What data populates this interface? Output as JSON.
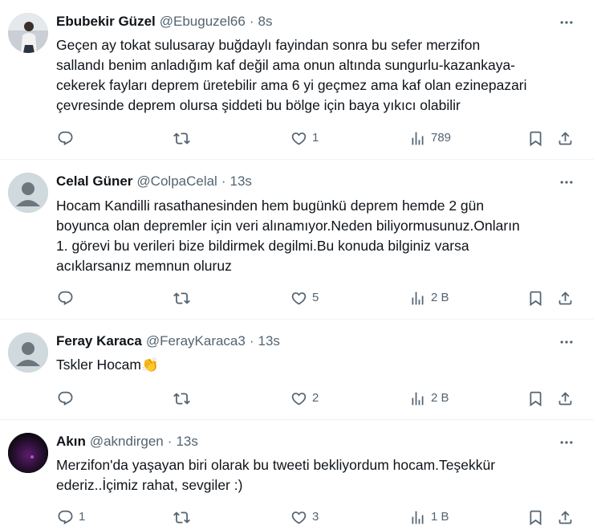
{
  "tweets": [
    {
      "name": "Ebubekir Güzel",
      "handle": "@Ebuguzel66",
      "time": "8s",
      "text": "Geçen ay tokat sulusaray buğdaylı fayindan sonra bu sefer merzifon\nsallandı benim anladığım kaf değil ama onun altında sungurlu-kazankaya-\ncekerek fayları deprem üretebilir ama 6 yi geçmez ama kaf olan ezinepazari\nçevresinde deprem olursa şiddeti bu bölge için baya yıkıcı olabilir",
      "replies": "",
      "retweets": "",
      "likes": "1",
      "views": "789"
    },
    {
      "name": "Celal Güner",
      "handle": "@ColpaCelal",
      "time": "13s",
      "text": "Hocam Kandilli rasathanesinden hem bugünkü deprem hemde 2 gün\nboyunca olan depremler için veri alınamıyor.Neden biliyormusunuz.Onların\n1. görevi bu verileri bize bildirmek degilmi.Bu konuda bilginiz varsa\nacıklarsanız memnun oluruz",
      "replies": "",
      "retweets": "",
      "likes": "5",
      "views": "2 B"
    },
    {
      "name": "Feray Karaca",
      "handle": "@FerayKaraca3",
      "time": "13s",
      "text": "Tskler Hocam👏",
      "replies": "",
      "retweets": "",
      "likes": "2",
      "views": "2 B"
    },
    {
      "name": "Akın",
      "handle": "@akndirgen",
      "time": "13s",
      "text": "Merzifon'da yaşayan biri olarak bu tweeti bekliyordum hocam.Teşekkür\nederiz..İçimiz rahat, sevgiler :)",
      "replies": "1",
      "retweets": "",
      "likes": "3",
      "views": "1 B"
    }
  ],
  "separator": "·",
  "colors": {
    "text": "#0f1419",
    "muted": "#536471",
    "border": "#eff3f4"
  }
}
